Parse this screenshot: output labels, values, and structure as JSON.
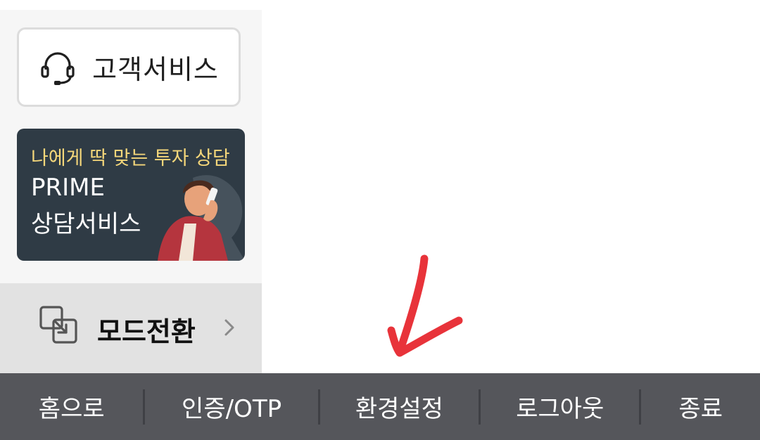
{
  "left_panel": {
    "customer_service": {
      "label": "고객서비스",
      "icon": "headset-icon"
    },
    "banner": {
      "headline": "나에게 딱 맞는 투자 상담",
      "title_line1": "PRIME",
      "title_line2": "상담서비스",
      "headline_color": "#f5d77a",
      "background_color": "#2f3b45"
    },
    "mode_switch": {
      "label": "모드전환",
      "icon": "switch-mode-icon",
      "chevron": "chevron-right-icon"
    }
  },
  "annotation": {
    "icon": "red-arrow-annotation",
    "color": "#e8333a"
  },
  "bottom_bar": {
    "background_color": "#55565b",
    "items": [
      {
        "label": "홈으로"
      },
      {
        "label": "인증/OTP"
      },
      {
        "label": "환경설정"
      },
      {
        "label": "로그아웃"
      },
      {
        "label": "종료"
      }
    ]
  }
}
